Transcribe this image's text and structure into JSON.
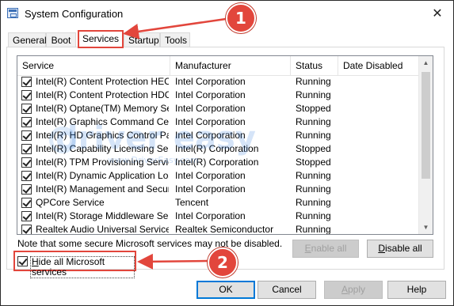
{
  "window": {
    "title": "System Configuration",
    "close_glyph": "✕"
  },
  "tabs": [
    {
      "label": "General",
      "active": false
    },
    {
      "label": "Boot",
      "active": false
    },
    {
      "label": "Services",
      "active": true
    },
    {
      "label": "Startup",
      "active": false
    },
    {
      "label": "Tools",
      "active": false
    }
  ],
  "columns": [
    "Service",
    "Manufacturer",
    "Status",
    "Date Disabled"
  ],
  "services": [
    {
      "name": "Intel(R) Content Protection HEC...",
      "manufacturer": "Intel Corporation",
      "status": "Running",
      "checked": true
    },
    {
      "name": "Intel(R) Content Protection HDC...",
      "manufacturer": "Intel Corporation",
      "status": "Running",
      "checked": true
    },
    {
      "name": "Intel(R) Optane(TM) Memory Se...",
      "manufacturer": "Intel Corporation",
      "status": "Stopped",
      "checked": true
    },
    {
      "name": "Intel(R) Graphics Command Cen...",
      "manufacturer": "Intel Corporation",
      "status": "Running",
      "checked": true
    },
    {
      "name": "Intel(R) HD Graphics Control Pa...",
      "manufacturer": "Intel Corporation",
      "status": "Running",
      "checked": true
    },
    {
      "name": "Intel(R) Capability Licensing Ser...",
      "manufacturer": "Intel(R) Corporation",
      "status": "Stopped",
      "checked": true
    },
    {
      "name": "Intel(R) TPM Provisioning Service",
      "manufacturer": "Intel(R) Corporation",
      "status": "Stopped",
      "checked": true
    },
    {
      "name": "Intel(R) Dynamic Application Loa...",
      "manufacturer": "Intel Corporation",
      "status": "Running",
      "checked": true
    },
    {
      "name": "Intel(R) Management and Securi...",
      "manufacturer": "Intel Corporation",
      "status": "Running",
      "checked": true
    },
    {
      "name": "QPCore Service",
      "manufacturer": "Tencent",
      "status": "Running",
      "checked": true
    },
    {
      "name": "Intel(R) Storage Middleware Serv...",
      "manufacturer": "Intel Corporation",
      "status": "Running",
      "checked": true
    },
    {
      "name": "Realtek Audio Universal Service",
      "manufacturer": "Realtek Semiconductor",
      "status": "Running",
      "checked": true
    }
  ],
  "note": "Note that some secure Microsoft services may not be disabled.",
  "enable_all": {
    "label_ul": "E",
    "label_rest": "nable all",
    "disabled": true
  },
  "disable_all": {
    "label_ul": "D",
    "label_rest": "isable all",
    "disabled": false
  },
  "hide_ms": {
    "label_ul": "H",
    "label_rest": "ide all Microsoft services",
    "checked": true
  },
  "buttons": {
    "ok": "OK",
    "cancel": "Cancel",
    "apply_ul": "A",
    "apply_rest": "pply",
    "help": "Help"
  },
  "annotations": {
    "step1": "1",
    "step2": "2"
  },
  "watermark": {
    "text": "driver easy",
    "sub": "www.DriverEasy.com"
  },
  "colors": {
    "annotation": "#e2463c",
    "focus_border": "#0078d7",
    "watermark": "#1e6fd9"
  }
}
